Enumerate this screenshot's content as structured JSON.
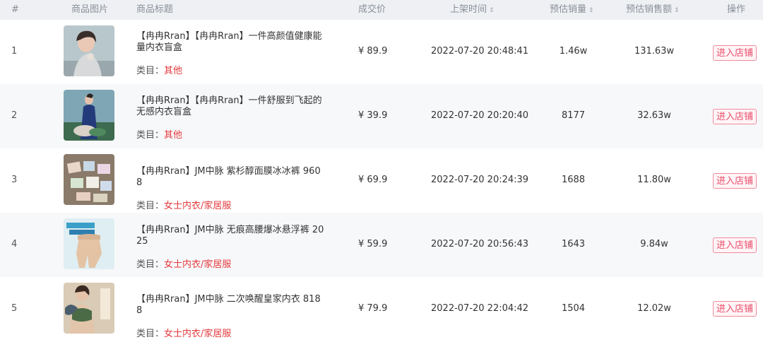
{
  "columns": {
    "index": "#",
    "image": "商品图片",
    "title": "商品标题",
    "price": "成交价",
    "listed_time": "上架时间",
    "est_sales": "预估销量",
    "est_amount": "预估销售额",
    "action": "操作"
  },
  "category_label": "类目：",
  "rows": [
    {
      "index": "1",
      "title": "【冉冉Rran】【冉冉Rran】一件高颜值健康能量内衣盲盒",
      "category": "其他",
      "price": "¥ 89.9",
      "time": "2022-07-20 20:48:41",
      "sales": "1.46w",
      "amount": "131.63w",
      "action": "进入店铺"
    },
    {
      "index": "2",
      "title": "【冉冉Rran】【冉冉Rran】一件舒服到飞起的无感内衣盲盒",
      "category": "其他",
      "price": "¥ 39.9",
      "time": "2022-07-20 20:20:40",
      "sales": "8177",
      "amount": "32.63w",
      "action": "进入店铺"
    },
    {
      "index": "3",
      "title": "【冉冉Rran】JM中脉 紫杉醇面膜冰冰裤 9608",
      "category": "女士内衣/家居服",
      "price": "¥ 69.9",
      "time": "2022-07-20 20:24:39",
      "sales": "1688",
      "amount": "11.80w",
      "action": "进入店铺"
    },
    {
      "index": "4",
      "title": "【冉冉Rran】JM中脉 无痕高腰爆冰悬浮裤 2025",
      "category": "女士内衣/家居服",
      "price": "¥ 59.9",
      "time": "2022-07-20 20:56:43",
      "sales": "1643",
      "amount": "9.84w",
      "action": "进入店铺"
    },
    {
      "index": "5",
      "title": "【冉冉Rran】JM中脉 二次唤醒皇家内衣 8188",
      "category": "女士内衣/家居服",
      "price": "¥ 79.9",
      "time": "2022-07-20 22:04:42",
      "sales": "1504",
      "amount": "12.02w",
      "action": "进入店铺"
    }
  ]
}
